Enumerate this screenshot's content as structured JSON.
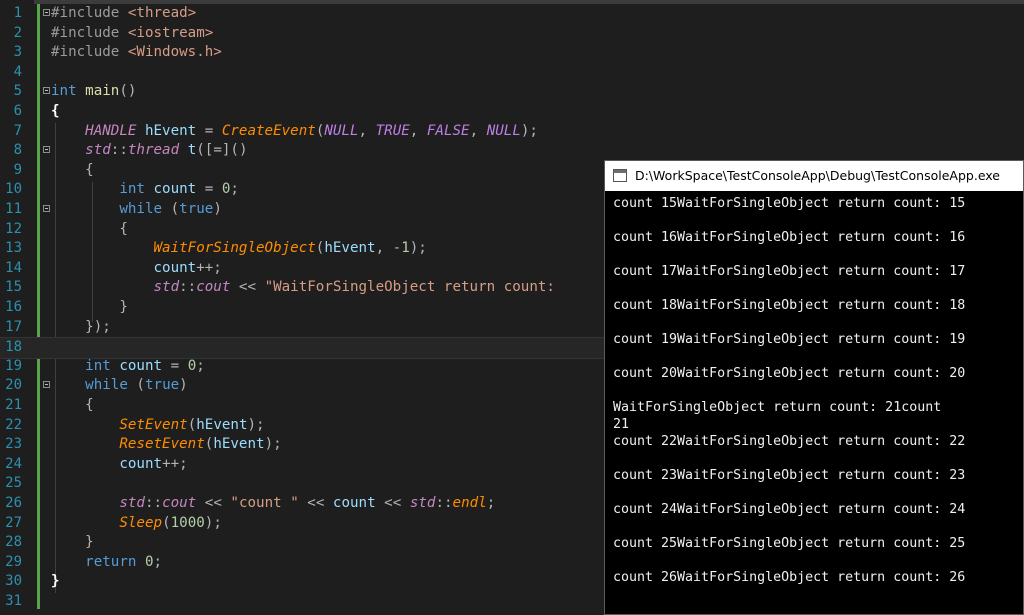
{
  "editor": {
    "lines": [
      {
        "n": "1",
        "tokens": [
          {
            "c": "pp",
            "t": "#include "
          },
          {
            "c": "inc",
            "t": "<thread>"
          }
        ],
        "fold": true
      },
      {
        "n": "2",
        "tokens": [
          {
            "c": "pp",
            "t": "#include "
          },
          {
            "c": "inc",
            "t": "<iostream>"
          }
        ]
      },
      {
        "n": "3",
        "tokens": [
          {
            "c": "pp",
            "t": "#include "
          },
          {
            "c": "inc",
            "t": "<Windows.h>"
          }
        ]
      },
      {
        "n": "4",
        "tokens": []
      },
      {
        "n": "5",
        "tokens": [
          {
            "c": "kw",
            "t": "int"
          },
          {
            "c": "",
            "t": " "
          },
          {
            "c": "fn",
            "t": "main"
          },
          {
            "c": "op",
            "t": "()"
          }
        ],
        "fold": true
      },
      {
        "n": "6",
        "tokens": [
          {
            "c": "brace",
            "t": "{"
          }
        ]
      },
      {
        "n": "7",
        "tokens": [
          {
            "c": "",
            "t": "    "
          },
          {
            "c": "ty",
            "t": "HANDLE"
          },
          {
            "c": "",
            "t": " "
          },
          {
            "c": "var",
            "t": "hEvent"
          },
          {
            "c": "op",
            "t": " = "
          },
          {
            "c": "call",
            "t": "CreateEvent"
          },
          {
            "c": "op",
            "t": "("
          },
          {
            "c": "mac",
            "t": "NULL"
          },
          {
            "c": "op",
            "t": ", "
          },
          {
            "c": "mac",
            "t": "TRUE"
          },
          {
            "c": "op",
            "t": ", "
          },
          {
            "c": "mac",
            "t": "FALSE"
          },
          {
            "c": "op",
            "t": ", "
          },
          {
            "c": "mac",
            "t": "NULL"
          },
          {
            "c": "op",
            "t": ");"
          }
        ]
      },
      {
        "n": "8",
        "tokens": [
          {
            "c": "",
            "t": "    "
          },
          {
            "c": "ty",
            "t": "std"
          },
          {
            "c": "op",
            "t": "::"
          },
          {
            "c": "ty",
            "t": "thread"
          },
          {
            "c": "",
            "t": " "
          },
          {
            "c": "var",
            "t": "t"
          },
          {
            "c": "op",
            "t": "([=]()"
          }
        ],
        "fold": true
      },
      {
        "n": "9",
        "tokens": [
          {
            "c": "",
            "t": "    "
          },
          {
            "c": "op",
            "t": "{"
          }
        ]
      },
      {
        "n": "10",
        "tokens": [
          {
            "c": "",
            "t": "        "
          },
          {
            "c": "kw",
            "t": "int"
          },
          {
            "c": "",
            "t": " "
          },
          {
            "c": "var",
            "t": "count"
          },
          {
            "c": "op",
            "t": " = "
          },
          {
            "c": "num",
            "t": "0"
          },
          {
            "c": "op",
            "t": ";"
          }
        ]
      },
      {
        "n": "11",
        "tokens": [
          {
            "c": "",
            "t": "        "
          },
          {
            "c": "kw",
            "t": "while"
          },
          {
            "c": "op",
            "t": " ("
          },
          {
            "c": "kw",
            "t": "true"
          },
          {
            "c": "op",
            "t": ")"
          }
        ],
        "fold": true
      },
      {
        "n": "12",
        "tokens": [
          {
            "c": "",
            "t": "        "
          },
          {
            "c": "op",
            "t": "{"
          }
        ]
      },
      {
        "n": "13",
        "tokens": [
          {
            "c": "",
            "t": "            "
          },
          {
            "c": "call",
            "t": "WaitForSingleObject"
          },
          {
            "c": "op",
            "t": "("
          },
          {
            "c": "var",
            "t": "hEvent"
          },
          {
            "c": "op",
            "t": ", -"
          },
          {
            "c": "num",
            "t": "1"
          },
          {
            "c": "op",
            "t": ");"
          }
        ]
      },
      {
        "n": "14",
        "tokens": [
          {
            "c": "",
            "t": "            "
          },
          {
            "c": "var",
            "t": "count"
          },
          {
            "c": "op",
            "t": "++;"
          }
        ]
      },
      {
        "n": "15",
        "tokens": [
          {
            "c": "",
            "t": "            "
          },
          {
            "c": "ty",
            "t": "std"
          },
          {
            "c": "op",
            "t": "::"
          },
          {
            "c": "ty",
            "t": "cout"
          },
          {
            "c": "op",
            "t": " << "
          },
          {
            "c": "str",
            "t": "\"WaitForSingleObject return count: "
          }
        ]
      },
      {
        "n": "16",
        "tokens": [
          {
            "c": "",
            "t": "        "
          },
          {
            "c": "op",
            "t": "}"
          }
        ]
      },
      {
        "n": "17",
        "tokens": [
          {
            "c": "",
            "t": "    "
          },
          {
            "c": "op",
            "t": "});"
          }
        ]
      },
      {
        "n": "18",
        "tokens": [],
        "current": true
      },
      {
        "n": "19",
        "tokens": [
          {
            "c": "",
            "t": "    "
          },
          {
            "c": "kw",
            "t": "int"
          },
          {
            "c": "",
            "t": " "
          },
          {
            "c": "var",
            "t": "count"
          },
          {
            "c": "op",
            "t": " = "
          },
          {
            "c": "num",
            "t": "0"
          },
          {
            "c": "op",
            "t": ";"
          }
        ]
      },
      {
        "n": "20",
        "tokens": [
          {
            "c": "",
            "t": "    "
          },
          {
            "c": "kw",
            "t": "while"
          },
          {
            "c": "op",
            "t": " ("
          },
          {
            "c": "kw",
            "t": "true"
          },
          {
            "c": "op",
            "t": ")"
          }
        ],
        "fold": true
      },
      {
        "n": "21",
        "tokens": [
          {
            "c": "",
            "t": "    "
          },
          {
            "c": "op",
            "t": "{"
          }
        ]
      },
      {
        "n": "22",
        "tokens": [
          {
            "c": "",
            "t": "        "
          },
          {
            "c": "call",
            "t": "SetEvent"
          },
          {
            "c": "op",
            "t": "("
          },
          {
            "c": "var",
            "t": "hEvent"
          },
          {
            "c": "op",
            "t": ");"
          }
        ]
      },
      {
        "n": "23",
        "tokens": [
          {
            "c": "",
            "t": "        "
          },
          {
            "c": "call",
            "t": "ResetEvent"
          },
          {
            "c": "op",
            "t": "("
          },
          {
            "c": "var",
            "t": "hEvent"
          },
          {
            "c": "op",
            "t": ");"
          }
        ]
      },
      {
        "n": "24",
        "tokens": [
          {
            "c": "",
            "t": "        "
          },
          {
            "c": "var",
            "t": "count"
          },
          {
            "c": "op",
            "t": "++;"
          }
        ]
      },
      {
        "n": "25",
        "tokens": []
      },
      {
        "n": "26",
        "tokens": [
          {
            "c": "",
            "t": "        "
          },
          {
            "c": "ty",
            "t": "std"
          },
          {
            "c": "op",
            "t": "::"
          },
          {
            "c": "ty",
            "t": "cout"
          },
          {
            "c": "op",
            "t": " << "
          },
          {
            "c": "str",
            "t": "\"count \""
          },
          {
            "c": "op",
            "t": " << "
          },
          {
            "c": "var",
            "t": "count"
          },
          {
            "c": "op",
            "t": " << "
          },
          {
            "c": "ty",
            "t": "std"
          },
          {
            "c": "op",
            "t": "::"
          },
          {
            "c": "call",
            "t": "endl"
          },
          {
            "c": "op",
            "t": ";"
          }
        ]
      },
      {
        "n": "27",
        "tokens": [
          {
            "c": "",
            "t": "        "
          },
          {
            "c": "call",
            "t": "Sleep"
          },
          {
            "c": "op",
            "t": "("
          },
          {
            "c": "num",
            "t": "1000"
          },
          {
            "c": "op",
            "t": ");"
          }
        ]
      },
      {
        "n": "28",
        "tokens": [
          {
            "c": "",
            "t": "    "
          },
          {
            "c": "op",
            "t": "}"
          }
        ]
      },
      {
        "n": "29",
        "tokens": [
          {
            "c": "",
            "t": "    "
          },
          {
            "c": "kw",
            "t": "return"
          },
          {
            "c": "",
            "t": " "
          },
          {
            "c": "num",
            "t": "0"
          },
          {
            "c": "op",
            "t": ";"
          }
        ]
      },
      {
        "n": "30",
        "tokens": [
          {
            "c": "brace",
            "t": "}"
          }
        ]
      },
      {
        "n": "31",
        "tokens": []
      }
    ]
  },
  "console": {
    "title": "D:\\WorkSpace\\TestConsoleApp\\Debug\\TestConsoleApp.exe",
    "lines": [
      "count 15WaitForSingleObject return count: 15",
      "",
      "count 16WaitForSingleObject return count: 16",
      "",
      "count 17WaitForSingleObject return count: 17",
      "",
      "count 18WaitForSingleObject return count: 18",
      "",
      "count 19WaitForSingleObject return count: 19",
      "",
      "count 20WaitForSingleObject return count: 20",
      "",
      "WaitForSingleObject return count: 21count",
      "21",
      "count 22WaitForSingleObject return count: 22",
      "",
      "count 23WaitForSingleObject return count: 23",
      "",
      "count 24WaitForSingleObject return count: 24",
      "",
      "count 25WaitForSingleObject return count: 25",
      "",
      "count 26WaitForSingleObject return count: 26"
    ]
  }
}
